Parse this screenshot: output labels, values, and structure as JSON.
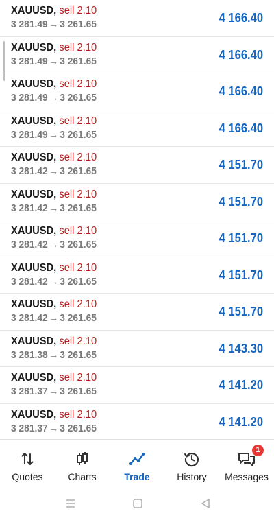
{
  "trades": [
    {
      "symbol": "XAUUSD,",
      "side": "sell",
      "volume": "2.10",
      "open_price": "3 281.49",
      "arrow": "→",
      "current_price": "3 261.65",
      "profit": "4 166.40"
    },
    {
      "symbol": "XAUUSD,",
      "side": "sell",
      "volume": "2.10",
      "open_price": "3 281.49",
      "arrow": "→",
      "current_price": "3 261.65",
      "profit": "4 166.40"
    },
    {
      "symbol": "XAUUSD,",
      "side": "sell",
      "volume": "2.10",
      "open_price": "3 281.49",
      "arrow": "→",
      "current_price": "3 261.65",
      "profit": "4 166.40"
    },
    {
      "symbol": "XAUUSD,",
      "side": "sell",
      "volume": "2.10",
      "open_price": "3 281.49",
      "arrow": "→",
      "current_price": "3 261.65",
      "profit": "4 166.40"
    },
    {
      "symbol": "XAUUSD,",
      "side": "sell",
      "volume": "2.10",
      "open_price": "3 281.42",
      "arrow": "→",
      "current_price": "3 261.65",
      "profit": "4 151.70"
    },
    {
      "symbol": "XAUUSD,",
      "side": "sell",
      "volume": "2.10",
      "open_price": "3 281.42",
      "arrow": "→",
      "current_price": "3 261.65",
      "profit": "4 151.70"
    },
    {
      "symbol": "XAUUSD,",
      "side": "sell",
      "volume": "2.10",
      "open_price": "3 281.42",
      "arrow": "→",
      "current_price": "3 261.65",
      "profit": "4 151.70"
    },
    {
      "symbol": "XAUUSD,",
      "side": "sell",
      "volume": "2.10",
      "open_price": "3 281.42",
      "arrow": "→",
      "current_price": "3 261.65",
      "profit": "4 151.70"
    },
    {
      "symbol": "XAUUSD,",
      "side": "sell",
      "volume": "2.10",
      "open_price": "3 281.42",
      "arrow": "→",
      "current_price": "3 261.65",
      "profit": "4 151.70"
    },
    {
      "symbol": "XAUUSD,",
      "side": "sell",
      "volume": "2.10",
      "open_price": "3 281.38",
      "arrow": "→",
      "current_price": "3 261.65",
      "profit": "4 143.30"
    },
    {
      "symbol": "XAUUSD,",
      "side": "sell",
      "volume": "2.10",
      "open_price": "3 281.37",
      "arrow": "→",
      "current_price": "3 261.65",
      "profit": "4 141.20"
    },
    {
      "symbol": "XAUUSD,",
      "side": "sell",
      "volume": "2.10",
      "open_price": "3 281.37",
      "arrow": "→",
      "current_price": "3 261.65",
      "profit": "4 141.20"
    }
  ],
  "bottom_nav": {
    "items": [
      {
        "label": "Quotes",
        "icon": "quotes-arrows-icon"
      },
      {
        "label": "Charts",
        "icon": "candlestick-icon"
      },
      {
        "label": "Trade",
        "icon": "trade-line-icon",
        "active": true
      },
      {
        "label": "History",
        "icon": "history-clock-icon"
      },
      {
        "label": "Messages",
        "icon": "messages-chat-icon",
        "badge": "1"
      }
    ]
  },
  "system_nav": {
    "icons": [
      "menu-lines-icon",
      "home-square-icon",
      "back-triangle-icon"
    ]
  },
  "colors": {
    "profit": "#1565c0",
    "sell": "#b71c1c",
    "active_tab": "#1565c0",
    "badge": "#e53935"
  }
}
